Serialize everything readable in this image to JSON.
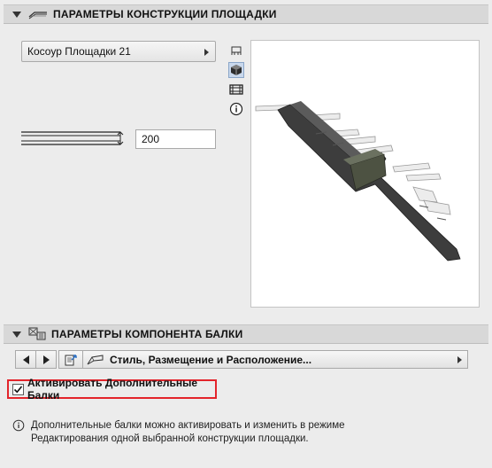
{
  "section1": {
    "title": "ПАРАМЕТРЫ КОНСТРУКЦИИ ПЛОЩАДКИ",
    "icon": "stair-structure-icon",
    "element_dropdown": {
      "value": "Косоур Площадки 21"
    },
    "view_icons": [
      "plan-view-icon",
      "3d-view-icon",
      "section-view-icon",
      "info-icon"
    ],
    "active_view": "3d-view-icon",
    "thickness_value": "200"
  },
  "section2": {
    "title": "ПАРАМЕТРЫ КОМПОНЕНТА БАЛКИ",
    "icon": "beam-component-icon",
    "tab_selector": {
      "value": "Стиль, Размещение и Расположение..."
    }
  },
  "checkbox": {
    "label": "Активировать Дополнительные Балки",
    "checked": true,
    "highlight_color": "#e3242b"
  },
  "info": {
    "text_line1": "Дополнительные балки можно активировать и изменить в режиме",
    "text_line2": "Редактирования одной выбранной конструкции площадки."
  }
}
